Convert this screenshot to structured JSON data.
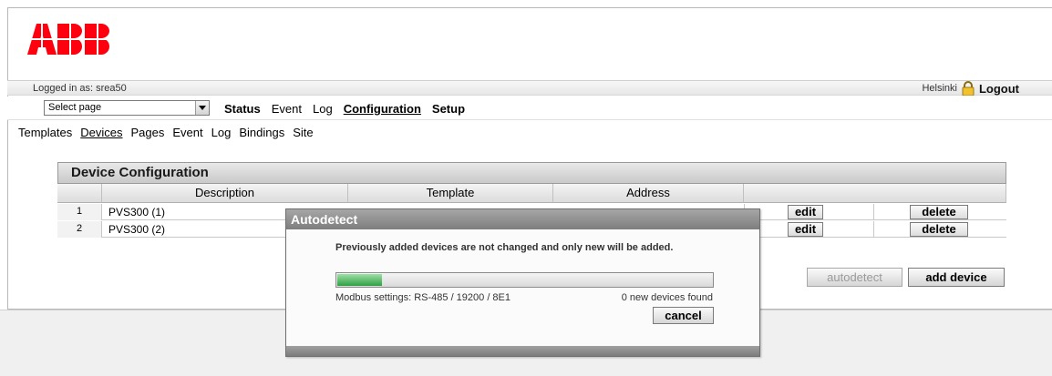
{
  "logo": {
    "text": "ABB",
    "color": "#ff000f"
  },
  "session": {
    "logged_in": "Logged in as: srea50",
    "city": "Helsinki",
    "logout": "Logout"
  },
  "menu": {
    "select_placeholder": "Select page",
    "items": [
      "Status",
      "Event",
      "Log",
      "Configuration",
      "Setup"
    ],
    "active": "Configuration"
  },
  "submenu": {
    "items": [
      "Templates",
      "Devices",
      "Pages",
      "Event",
      "Log",
      "Bindings",
      "Site"
    ],
    "active": "Devices"
  },
  "panel": {
    "title": "Device Configuration",
    "columns": [
      "Description",
      "Template",
      "Address"
    ],
    "rows": [
      {
        "num": "1",
        "description": "PVS300 (1)",
        "edit": "edit",
        "delete": "delete"
      },
      {
        "num": "2",
        "description": "PVS300 (2)",
        "edit": "edit",
        "delete": "delete"
      }
    ],
    "autodetect": "autodetect",
    "add_device": "add device"
  },
  "modal": {
    "title": "Autodetect",
    "message": "Previously added devices are not changed and only new will be added.",
    "progress": 0.12,
    "modbus": "Modbus settings: RS-485 / 19200 / 8E1",
    "found": "0 new devices found",
    "cancel": "cancel"
  }
}
